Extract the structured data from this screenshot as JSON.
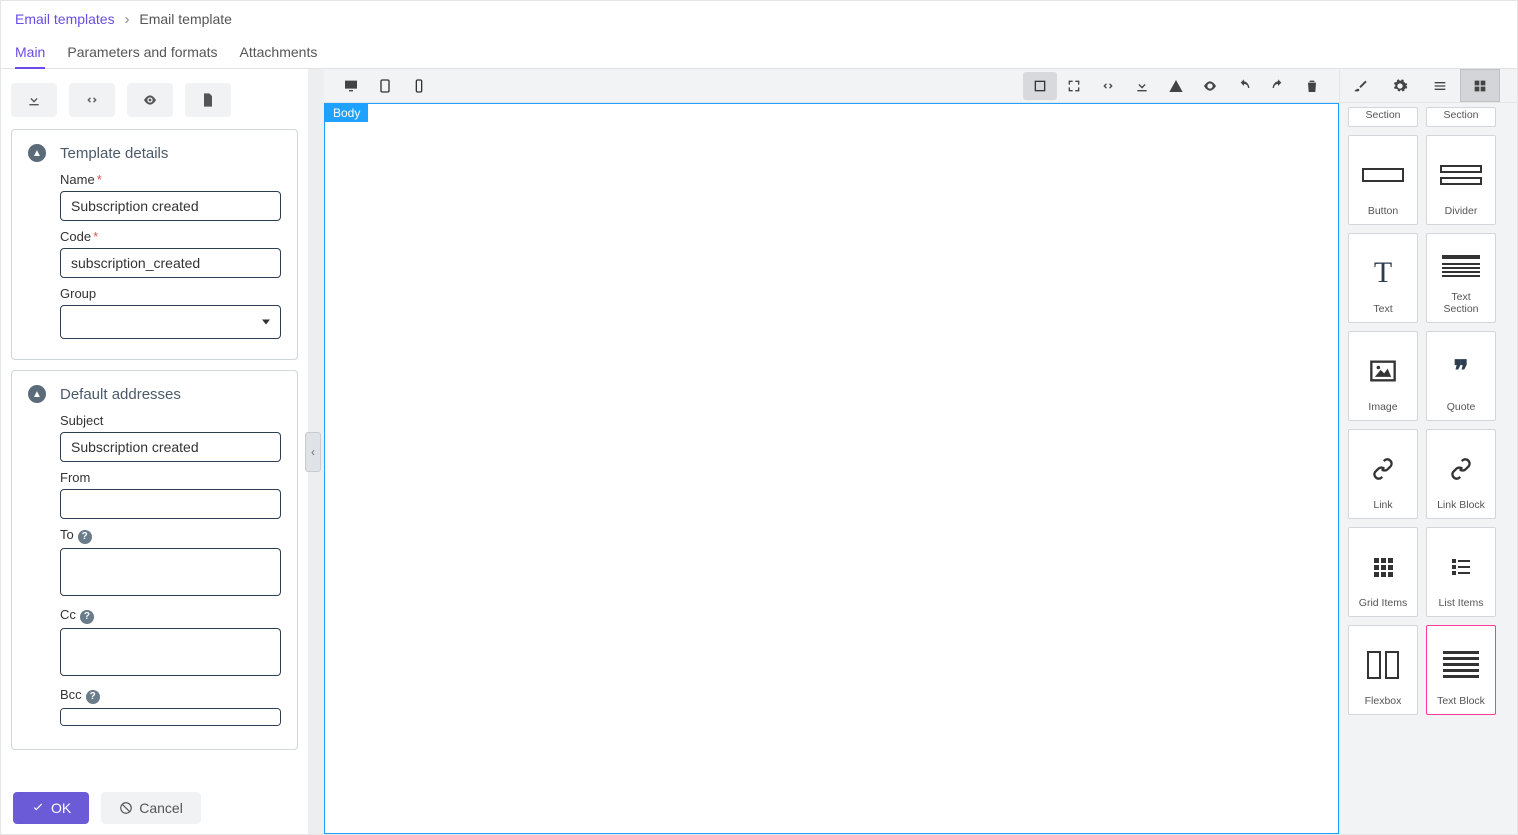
{
  "breadcrumb": {
    "parent": "Email templates",
    "current": "Email template"
  },
  "tabs": {
    "main": "Main",
    "params": "Parameters and formats",
    "attach": "Attachments"
  },
  "details": {
    "title": "Template details",
    "name_label": "Name",
    "name_value": "Subscription created",
    "code_label": "Code",
    "code_value": "subscription_created",
    "group_label": "Group",
    "group_value": ""
  },
  "addresses": {
    "title": "Default addresses",
    "subject_label": "Subject",
    "subject_value": "Subscription created",
    "from_label": "From",
    "from_value": "",
    "to_label": "To",
    "to_value": "",
    "cc_label": "Cc",
    "cc_value": "",
    "bcc_label": "Bcc",
    "bcc_value": ""
  },
  "footer": {
    "ok": "OK",
    "cancel": "Cancel"
  },
  "canvas": {
    "tag": "Body"
  },
  "blocks": {
    "section_top_a": "Section",
    "section_top_b": "Section",
    "button": "Button",
    "divider": "Divider",
    "text": "Text",
    "text_section": "Text\nSection",
    "image": "Image",
    "quote": "Quote",
    "link": "Link",
    "link_block": "Link Block",
    "grid_items": "Grid Items",
    "list_items": "List Items",
    "flexbox": "Flexbox",
    "text_block": "Text Block"
  }
}
